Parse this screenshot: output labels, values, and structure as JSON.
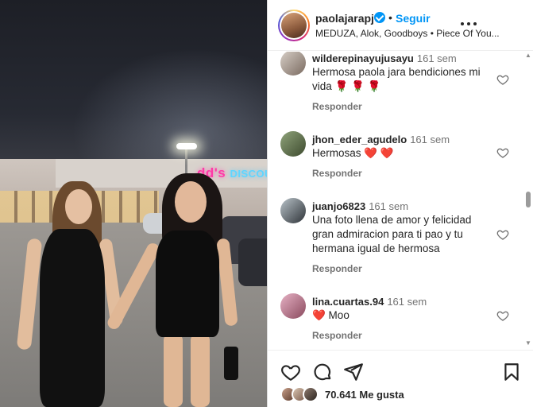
{
  "post": {
    "username": "paolajarapj",
    "dot": "•",
    "follow_label": "Seguir",
    "audio": "MEDUZA, Alok, Goodboys • Piece Of You..."
  },
  "comments": [
    {
      "user": "wilderepinayujusayu",
      "time": "161 sem",
      "text": "Hermosa paola jara bendiciones mi vida 🌹 🌹 🌹",
      "reply": "Responder"
    },
    {
      "user": "jhon_eder_agudelo",
      "time": "161 sem",
      "text": "Hermosas ❤️ ❤️",
      "reply": "Responder"
    },
    {
      "user": "juanjo6823",
      "time": "161 sem",
      "text": "Una foto llena de amor y felicidad gran admiracion para ti pao y tu hermana igual de hermosa",
      "reply": "Responder"
    },
    {
      "user": "lina.cuartas.94",
      "time": "161 sem",
      "text": "❤️ Moo",
      "reply": "Responder"
    }
  ],
  "likes": {
    "text": "70.641 Me gusta"
  },
  "icons": {
    "like": "heart-icon",
    "comment": "comment-icon",
    "share": "share-icon",
    "save": "bookmark-icon",
    "more": "more-icon"
  },
  "colors": {
    "link": "#0095f6",
    "text": "#262626",
    "muted": "#737373"
  },
  "media": {
    "sign_pink": "dd's",
    "sign_blue": "DISCOU"
  }
}
